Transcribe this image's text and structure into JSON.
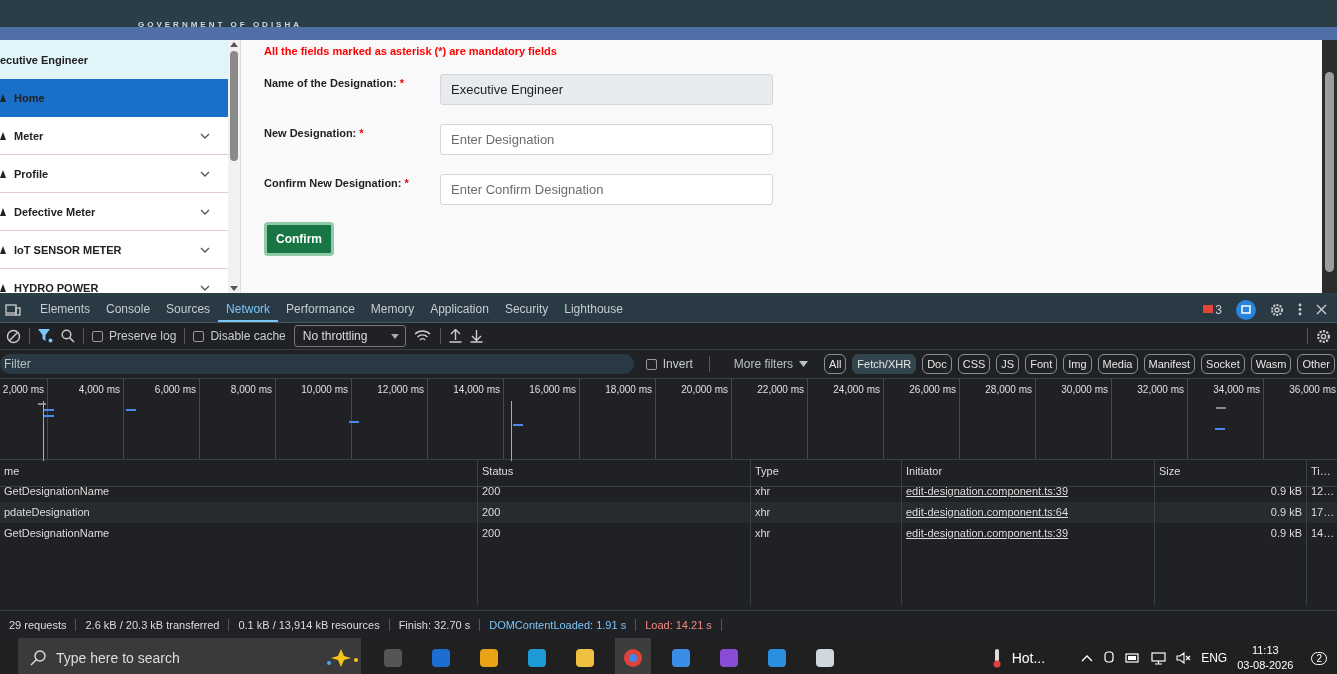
{
  "header": {
    "org": "GOVERNMENT OF ODISHA"
  },
  "sidebar": {
    "user": "ecutive Engineer",
    "items": [
      {
        "label": "Home",
        "kind": "link",
        "selected": true
      },
      {
        "label": "Meter",
        "kind": "group",
        "selected": false
      },
      {
        "label": "Profile",
        "kind": "group",
        "selected": false
      },
      {
        "label": "Defective Meter",
        "kind": "group",
        "selected": false
      },
      {
        "label": "IoT SENSOR METER",
        "kind": "group",
        "selected": false
      },
      {
        "label": "HYDRO POWER",
        "kind": "group",
        "selected": false
      }
    ]
  },
  "form": {
    "notice": "All the fields marked as asterisk (*) are mandatory fields",
    "fields": [
      {
        "label": "Name of the Designation:",
        "marker": "*",
        "value": "Executive Engineer",
        "disabled": true
      },
      {
        "label": "New Designation:",
        "marker": "*",
        "placeholder": "Enter Designation",
        "disabled": false
      },
      {
        "label": "Confirm New Designation:",
        "marker": "*",
        "placeholder": "Enter Confirm Designation",
        "disabled": false
      }
    ],
    "button": "Confirm"
  },
  "devtools": {
    "tabs": [
      {
        "label": "Elements",
        "selected": false
      },
      {
        "label": "Console",
        "selected": false
      },
      {
        "label": "Sources",
        "selected": false
      },
      {
        "label": "Network",
        "selected": true
      },
      {
        "label": "Performance",
        "selected": false
      },
      {
        "label": "Memory",
        "selected": false
      },
      {
        "label": "Application",
        "selected": false
      },
      {
        "label": "Security",
        "selected": false
      },
      {
        "label": "Lighthouse",
        "selected": false
      }
    ],
    "issues_count": "3",
    "preserve_log": {
      "label": "Preserve log",
      "checked": false
    },
    "disable_cache": {
      "label": "Disable cache",
      "checked": false
    },
    "throttling": "No throttling",
    "filter": {
      "placeholder": "Filter"
    },
    "invert": {
      "label": "Invert",
      "checked": false
    },
    "more_filters": "More filters",
    "type_filters": [
      {
        "label": "All",
        "selected": false
      },
      {
        "label": "Fetch/XHR",
        "selected": true
      },
      {
        "label": "Doc",
        "selected": false
      },
      {
        "label": "CSS",
        "selected": false
      },
      {
        "label": "JS",
        "selected": false
      },
      {
        "label": "Font",
        "selected": false
      },
      {
        "label": "Img",
        "selected": false
      },
      {
        "label": "Media",
        "selected": false
      },
      {
        "label": "Manifest",
        "selected": false
      },
      {
        "label": "Socket",
        "selected": false
      },
      {
        "label": "Wasm",
        "selected": false
      },
      {
        "label": "Other",
        "selected": false
      }
    ],
    "timeline_ticks": [
      "2,000 ms",
      "4,000 ms",
      "6,000 ms",
      "8,000 ms",
      "10,000 ms",
      "12,000 ms",
      "14,000 ms",
      "16,000 ms",
      "18,000 ms",
      "20,000 ms",
      "22,000 ms",
      "24,000 ms",
      "26,000 ms",
      "28,000 ms",
      "30,000 ms",
      "32,000 ms",
      "34,000 ms",
      "36,000 ms"
    ],
    "table": {
      "columns": [
        "me",
        "Status",
        "Type",
        "Initiator",
        "Size",
        "Ti…"
      ],
      "rows": [
        [
          "GetDesignationName",
          "200",
          "xhr",
          "edit-designation.component.ts:39",
          "0.9 kB",
          "12…"
        ],
        [
          "pdateDesignation",
          "200",
          "xhr",
          "edit-designation.component.ts:64",
          "0.9 kB",
          "17…"
        ],
        [
          "GetDesignationName",
          "200",
          "xhr",
          "edit-designation.component.ts:39",
          "0.9 kB",
          "14…"
        ]
      ]
    },
    "summary": [
      "29 requests",
      "2.6 kB / 20.3 kB transferred",
      "0.1 kB / 13,914 kB resources",
      "Finish: 32.70 s",
      "DOMContentLoaded: 1.91 s",
      "Load: 14.21 s"
    ]
  },
  "taskbar": {
    "search_placeholder": "Type here to search",
    "weather": "Hot...",
    "language": "ENG",
    "time": "11:13",
    "date": "03-08-2026",
    "notifications": "2"
  }
}
